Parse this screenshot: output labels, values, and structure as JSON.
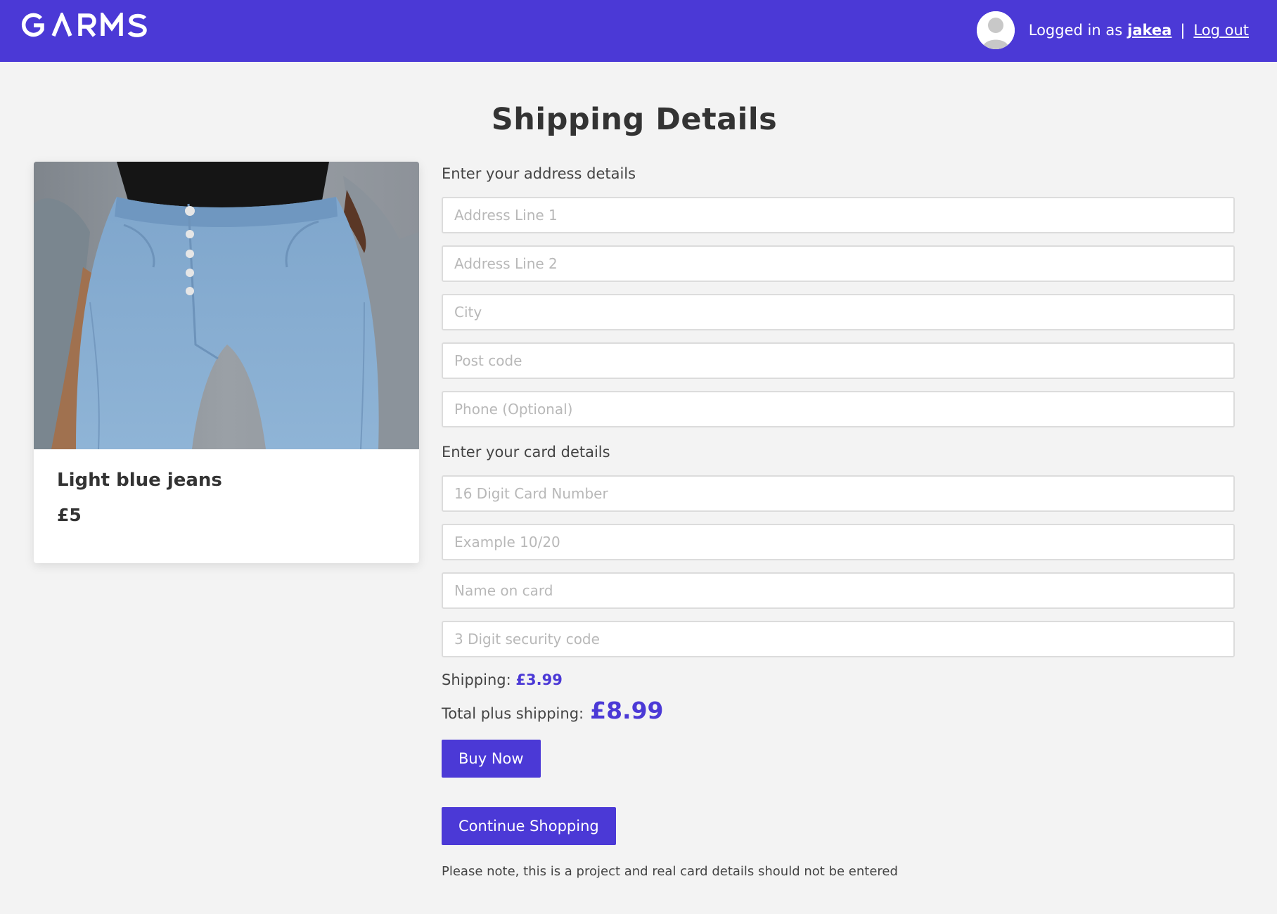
{
  "header": {
    "brand": "GARMS",
    "logged_in_prefix": "Logged in as",
    "username": "jakea",
    "separator": "|",
    "logout_label": "Log out",
    "accent_color": "#4b39d6"
  },
  "page": {
    "title": "Shipping Details"
  },
  "product": {
    "name": "Light blue jeans",
    "price": "£5",
    "image": "light-blue-jeans-photo"
  },
  "address": {
    "section_label": "Enter your address details",
    "fields": [
      {
        "placeholder": "Address Line 1",
        "value": ""
      },
      {
        "placeholder": "Address Line 2",
        "value": ""
      },
      {
        "placeholder": "City",
        "value": ""
      },
      {
        "placeholder": "Post code",
        "value": ""
      },
      {
        "placeholder": "Phone (Optional)",
        "value": ""
      }
    ]
  },
  "card": {
    "section_label": "Enter your card details",
    "fields": [
      {
        "placeholder": "16 Digit Card Number",
        "value": ""
      },
      {
        "placeholder": "Example 10/20",
        "value": ""
      },
      {
        "placeholder": "Name on card",
        "value": ""
      },
      {
        "placeholder": "3 Digit security code",
        "value": ""
      }
    ]
  },
  "summary": {
    "shipping_label": "Shipping:",
    "shipping_amount": "£3.99",
    "total_label": "Total plus shipping:",
    "total_amount": "£8.99"
  },
  "actions": {
    "buy_label": "Buy Now",
    "continue_label": "Continue Shopping"
  },
  "note": "Please note, this is a project and real card details should not be entered"
}
